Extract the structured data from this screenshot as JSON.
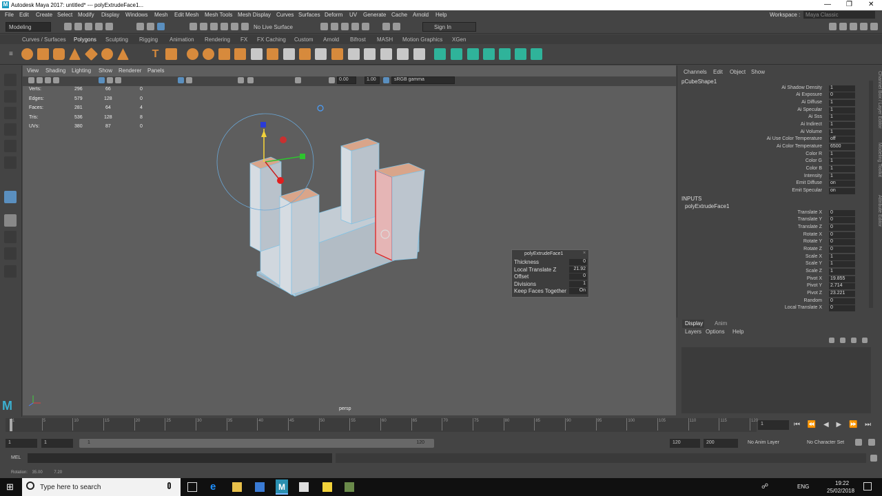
{
  "window": {
    "title": "Autodesk Maya 2017: untitled*   ---   polyExtrudeFace1..."
  },
  "menubar": {
    "items": [
      "File",
      "Edit",
      "Create",
      "Select",
      "Modify",
      "Display",
      "Windows",
      "Mesh",
      "Edit Mesh",
      "Mesh Tools",
      "Mesh Display",
      "Curves",
      "Surfaces",
      "Deform",
      "UV",
      "Generate",
      "Cache",
      "Arnold",
      "Help"
    ],
    "workspace_label": "Workspace :",
    "workspace_value": "Maya Classic"
  },
  "statusline": {
    "mode": "Modeling",
    "live_surface": "No Live Surface",
    "sign_in": "Sign In"
  },
  "shelf_tabs": [
    "Curves / Surfaces",
    "Polygons",
    "Sculpting",
    "Rigging",
    "Animation",
    "Rendering",
    "FX",
    "FX Caching",
    "Custom",
    "Arnold",
    "Bifrost",
    "MASH",
    "Motion Graphics",
    "XGen"
  ],
  "viewport": {
    "menu": [
      "View",
      "Shading",
      "Lighting",
      "Show",
      "Renderer",
      "Panels"
    ],
    "field1": "0.00",
    "field2": "1.00",
    "colorspace": "sRGB gamma",
    "camera_label": "persp",
    "hud": [
      {
        "label": "Verts:",
        "a": "296",
        "b": "66",
        "c": "0"
      },
      {
        "label": "Edges:",
        "a": "579",
        "b": "128",
        "c": "0"
      },
      {
        "label": "Faces:",
        "a": "281",
        "b": "64",
        "c": "4"
      },
      {
        "label": "Tris:",
        "a": "536",
        "b": "128",
        "c": "8"
      },
      {
        "label": "UVs:",
        "a": "380",
        "b": "87",
        "c": "0"
      }
    ]
  },
  "floating_window": {
    "title": "polyExtrudeFace1",
    "rows": [
      {
        "label": "Thickness",
        "value": "0"
      },
      {
        "label": "Local Translate Z",
        "value": "21.92"
      },
      {
        "label": "Offset",
        "value": "0"
      },
      {
        "label": "Divisions",
        "value": "1"
      },
      {
        "label": "Keep Faces Together",
        "value": "On"
      }
    ]
  },
  "channel_box": {
    "menu": [
      "Channels",
      "Edit",
      "Object",
      "Show"
    ],
    "shape_name": "pCubeShape1",
    "shape_attrs": [
      {
        "label": "Ai Shadow Density",
        "value": "1"
      },
      {
        "label": "Ai Exposure",
        "value": "0"
      },
      {
        "label": "Ai Diffuse",
        "value": "1"
      },
      {
        "label": "Ai Specular",
        "value": "1"
      },
      {
        "label": "Ai Sss",
        "value": "1"
      },
      {
        "label": "Ai Indirect",
        "value": "1"
      },
      {
        "label": "Ai Volume",
        "value": "1"
      },
      {
        "label": "Ai Use Color Temperature",
        "value": "off"
      },
      {
        "label": "Ai Color Temperature",
        "value": "6500"
      },
      {
        "label": "Color R",
        "value": "1"
      },
      {
        "label": "Color G",
        "value": "1"
      },
      {
        "label": "Color B",
        "value": "1"
      },
      {
        "label": "Intensity",
        "value": "1"
      },
      {
        "label": "Emit Diffuse",
        "value": "on"
      },
      {
        "label": "Emit Specular",
        "value": "on"
      }
    ],
    "inputs_label": "INPUTS",
    "input_name": "polyExtrudeFace1",
    "input_attrs": [
      {
        "label": "Translate X",
        "value": "0"
      },
      {
        "label": "Translate Y",
        "value": "0"
      },
      {
        "label": "Translate Z",
        "value": "0"
      },
      {
        "label": "Rotate X",
        "value": "0"
      },
      {
        "label": "Rotate Y",
        "value": "0"
      },
      {
        "label": "Rotate Z",
        "value": "0"
      },
      {
        "label": "Scale X",
        "value": "1"
      },
      {
        "label": "Scale Y",
        "value": "1"
      },
      {
        "label": "Scale Z",
        "value": "1"
      },
      {
        "label": "Pivot X",
        "value": "19.855"
      },
      {
        "label": "Pivot Y",
        "value": "2.714"
      },
      {
        "label": "Pivot Z",
        "value": "23.221"
      },
      {
        "label": "Random",
        "value": "0"
      },
      {
        "label": "Local Translate X",
        "value": "0"
      }
    ],
    "side_tabs": [
      "Channel Box / Layer Editor",
      "Modeling Toolkit",
      "Attribute Editor"
    ]
  },
  "layer_editor": {
    "tabs": [
      "Display",
      "Anim"
    ],
    "menu": [
      "Layers",
      "Options",
      "Help"
    ]
  },
  "timeline": {
    "ticks": [
      "1",
      "5",
      "10",
      "15",
      "20",
      "25",
      "30",
      "35",
      "40",
      "45",
      "50",
      "55",
      "60",
      "65",
      "70",
      "75",
      "80",
      "85",
      "90",
      "95",
      "100",
      "105",
      "110",
      "115",
      "120"
    ],
    "current": "1"
  },
  "range": {
    "start": "1",
    "anim_start": "1",
    "slider_start": "1",
    "slider_end": "120",
    "anim_end": "120",
    "end": "200",
    "anim_layer": "No Anim Layer",
    "char_set": "No Character Set"
  },
  "cmdline": {
    "lang": "MEL"
  },
  "helpline": {
    "text": "Rotation:    35.00          7.20"
  },
  "taskbar": {
    "search": "Type here to search",
    "lang": "ENG",
    "time": "19:22",
    "date": "25/02/2018"
  }
}
